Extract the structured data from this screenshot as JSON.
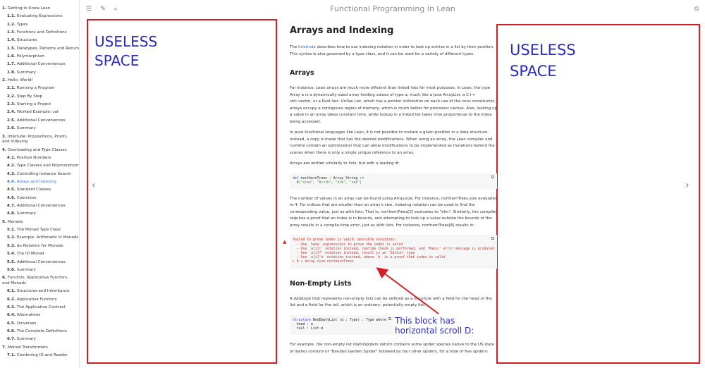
{
  "book_title": "Functional Programming in Lean",
  "toc": [
    {
      "num": "1.",
      "label": "Getting to Know Lean",
      "level": 1
    },
    {
      "num": "1.1.",
      "label": "Evaluating Expressions",
      "level": 2
    },
    {
      "num": "1.2.",
      "label": "Types",
      "level": 2
    },
    {
      "num": "1.3.",
      "label": "Functions and Definitions",
      "level": 2
    },
    {
      "num": "1.4.",
      "label": "Structures",
      "level": 2
    },
    {
      "num": "1.5.",
      "label": "Datatypes, Patterns and Recursion",
      "level": 2
    },
    {
      "num": "1.6.",
      "label": "Polymorphism",
      "level": 2
    },
    {
      "num": "1.7.",
      "label": "Additional Conveniences",
      "level": 2
    },
    {
      "num": "1.8.",
      "label": "Summary",
      "level": 2
    },
    {
      "num": "2.",
      "label": "Hello, World!",
      "level": 1
    },
    {
      "num": "2.1.",
      "label": "Running a Program",
      "level": 2
    },
    {
      "num": "2.2.",
      "label": "Step By Step",
      "level": 2
    },
    {
      "num": "2.3.",
      "label": "Starting a Project",
      "level": 2
    },
    {
      "num": "2.4.",
      "label": "Worked Example: cat",
      "level": 2
    },
    {
      "num": "2.5.",
      "label": "Additional Conveniences",
      "level": 2
    },
    {
      "num": "2.6.",
      "label": "Summary",
      "level": 2
    },
    {
      "num": "3.",
      "label": "Interlude: Propositions, Proofs, and Indexing",
      "level": 1,
      "wrap": true
    },
    {
      "num": "4.",
      "label": "Overloading and Type Classes",
      "level": 1
    },
    {
      "num": "4.1.",
      "label": "Positive Numbers",
      "level": 2
    },
    {
      "num": "4.2.",
      "label": "Type Classes and Polymorphism",
      "level": 2
    },
    {
      "num": "4.3.",
      "label": "Controlling Instance Search",
      "level": 2
    },
    {
      "num": "4.4.",
      "label": "Arrays and Indexing",
      "level": 2,
      "active": true
    },
    {
      "num": "4.5.",
      "label": "Standard Classes",
      "level": 2
    },
    {
      "num": "4.6.",
      "label": "Coercions",
      "level": 2
    },
    {
      "num": "4.7.",
      "label": "Additional Conveniences",
      "level": 2
    },
    {
      "num": "4.8.",
      "label": "Summary",
      "level": 2
    },
    {
      "num": "5.",
      "label": "Monads",
      "level": 1
    },
    {
      "num": "5.1.",
      "label": "The Monad Type Class",
      "level": 2
    },
    {
      "num": "5.2.",
      "label": "Example: Arithmetic in Monads",
      "level": 2
    },
    {
      "num": "5.3.",
      "label": "do-Notation for Monads",
      "level": 2
    },
    {
      "num": "5.4.",
      "label": "The IO Monad",
      "level": 2
    },
    {
      "num": "5.5.",
      "label": "Additional Conveniences",
      "level": 2
    },
    {
      "num": "5.6.",
      "label": "Summary",
      "level": 2
    },
    {
      "num": "6.",
      "label": "Functors, Applicative Functors, and Monads",
      "level": 1,
      "wrap": true
    },
    {
      "num": "6.1.",
      "label": "Structures and Inheritance",
      "level": 2
    },
    {
      "num": "6.2.",
      "label": "Applicative Functors",
      "level": 2
    },
    {
      "num": "6.3.",
      "label": "The Applicative Contract",
      "level": 2
    },
    {
      "num": "6.4.",
      "label": "Alternatives",
      "level": 2
    },
    {
      "num": "6.5.",
      "label": "Universes",
      "level": 2
    },
    {
      "num": "6.6.",
      "label": "The Complete Definitions",
      "level": 2
    },
    {
      "num": "6.7.",
      "label": "Summary",
      "level": 2
    },
    {
      "num": "7.",
      "label": "Monad Transformers",
      "level": 1
    },
    {
      "num": "7.1.",
      "label": "Combining IO and Reader",
      "level": 2
    }
  ],
  "annotations": {
    "useless_left_line1": "USELESS",
    "useless_left_line2": "SPACE",
    "useless_right_line1": "USELESS",
    "useless_right_line2": "SPACE",
    "scroll_note_line1": "This block has",
    "scroll_note_line2": "horizontal scroll D:",
    "colors": {
      "box": "#d11f24",
      "text": "#2b2bc4"
    }
  },
  "content": {
    "h1": "Arrays and Indexing",
    "intro_pre": "The ",
    "intro_link": "Interlude",
    "intro_post": " describes how to use indexing notation in order to look up entries in a list by their position. This syntax is also governed by a type class, and it can be used for a variety of different types.",
    "h2_arrays": "Arrays",
    "p_arrays_1": "For instance, Lean arrays are much more efficient than linked lists for most purposes. In Lean, the type Array α is a dynamically-sized array holding values of type α, much like a Java ArrayList, a C++ std::vector, or a Rust Vec. Unlike List, which has a pointer indirection on each use of the cons constructor, arrays occupy a contiguous region of memory, which is much better for processor caches. Also, looking up a value in an array takes constant time, while lookup in a linked list takes time proportional to the index being accessed.",
    "p_arrays_2": "In pure functional languages like Lean, it is not possible to mutate a given position in a data structure. Instead, a copy is made that has the desired modifications. When using an array, the Lean compiler and runtime contain an optimization that can allow modifications to be implemented as mutations behind the scenes when there is only a single unique reference to an array.",
    "p_arrays_3": "Arrays are written similarly to lists, but with a leading #:",
    "code1_line1_kw": "def",
    "code1_line1_rest": " northernTrees : Array String :=",
    "code1_line2": "  #[\"sloe\", \"birch\", \"elm\", \"oak\"]",
    "p_size": "The number of values in an array can be found using Array.size. For instance, northernTrees.size evaluates to 4. For indices that are smaller than an array's size, indexing notation can be used to find the corresponding value, just as with lists. That is, northernTrees[2] evaluates to \"elm\". Similarly, the compiler requires a proof that an index is in bounds, and attempting to look up a value outside the bounds of the array results in a compile-time error, just as with lists. For instance, northernTrees[8] results in:",
    "error_lines": [
      "failed to prove index is valid, possible solutions:",
      "  - Use `have`-expressions to prove the index is valid",
      "  - Use `a[i]!` notation instead, runtime check is performed, and 'Panic' error message is produced if index is not valid",
      "  - Use `a[i]?` notation instead, result is an `Option` type",
      "  - Use `a[i]'h` notation instead, where `h` is a proof that index is valid",
      "⊢ 8 < Array.size northernTrees"
    ],
    "h2_nonempty": "Non-Empty Lists",
    "p_nonempty": "A datatype that represents non-empty lists can be defined as a structure with a field for the head of the list and a field for the tail, which is an ordinary, potentially empty list:",
    "code2_line1_kw": "structure",
    "code2_line1_rest": " NonEmptyList (α : Type) : Type where",
    "code2_line2": "  head : α",
    "code2_line3": "  tail : List α",
    "p_example": "For example, the non-empty list idahoSpiders (which contains some spider species native to the US state of Idaho) consists of \"Banded Garden Spider\" followed by four other spiders, for a total of five spiders:"
  }
}
